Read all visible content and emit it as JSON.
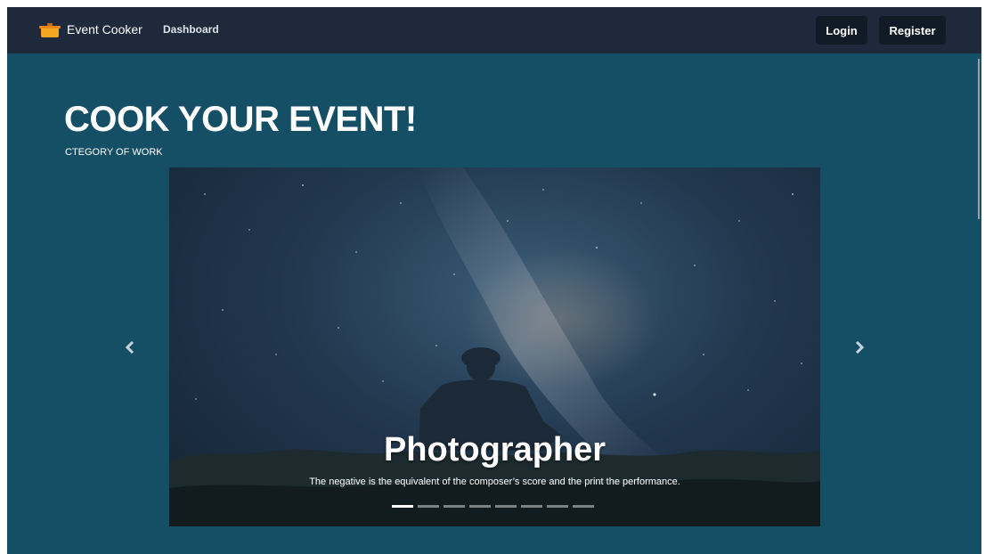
{
  "navbar": {
    "brand": "Event Cooker",
    "brand_icon": "cooking-pot-icon",
    "links": [
      "Dashboard"
    ],
    "login_label": "Login",
    "register_label": "Register"
  },
  "hero": {
    "title": "COOK YOUR EVENT!",
    "subtitle": "CTEGORY OF WORK"
  },
  "carousel": {
    "slide_title": "Photographer",
    "slide_caption": "The negative is the equivalent of the composer’s score and the print the performance.",
    "indicator_count": 8,
    "active_index": 0,
    "prev_icon": "chevron-left-icon",
    "next_icon": "chevron-right-icon"
  },
  "colors": {
    "navbar_bg": "#1e2a3c",
    "page_bg": "#154f66",
    "button_bg": "#111a27",
    "logo_orange": "#f5a623"
  }
}
